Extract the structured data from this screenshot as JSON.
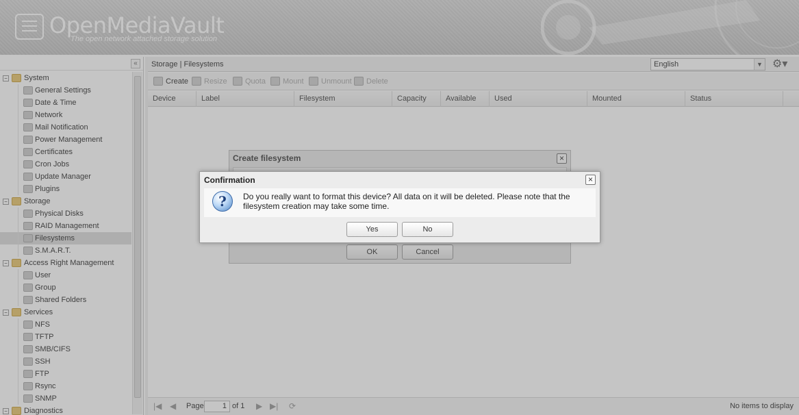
{
  "header": {
    "title": "OpenMediaVault",
    "subtitle": "The open network attached storage solution"
  },
  "sidebar": {
    "tree": [
      {
        "type": "category",
        "label": "System",
        "icon": "folder-icon",
        "expanded": true
      },
      {
        "type": "leaf",
        "label": "General Settings",
        "icon": "tools-icon"
      },
      {
        "type": "leaf",
        "label": "Date & Time",
        "icon": "clock-icon"
      },
      {
        "type": "leaf",
        "label": "Network",
        "icon": "network-icon"
      },
      {
        "type": "leaf",
        "label": "Mail Notification",
        "icon": "mail-icon"
      },
      {
        "type": "leaf",
        "label": "Power Management",
        "icon": "power-icon"
      },
      {
        "type": "leaf",
        "label": "Certificates",
        "icon": "certificate-icon"
      },
      {
        "type": "leaf",
        "label": "Cron Jobs",
        "icon": "cron-icon"
      },
      {
        "type": "leaf",
        "label": "Update Manager",
        "icon": "update-icon"
      },
      {
        "type": "leaf",
        "label": "Plugins",
        "icon": "plugin-icon"
      },
      {
        "type": "category",
        "label": "Storage",
        "icon": "folder-icon",
        "expanded": true
      },
      {
        "type": "leaf",
        "label": "Physical Disks",
        "icon": "disk-icon"
      },
      {
        "type": "leaf",
        "label": "RAID Management",
        "icon": "raid-icon"
      },
      {
        "type": "leaf",
        "label": "Filesystems",
        "icon": "filesystem-icon",
        "selected": true
      },
      {
        "type": "leaf",
        "label": "S.M.A.R.T.",
        "icon": "smart-icon"
      },
      {
        "type": "category",
        "label": "Access Right Management",
        "icon": "folder-icon",
        "expanded": true
      },
      {
        "type": "leaf",
        "label": "User",
        "icon": "user-icon"
      },
      {
        "type": "leaf",
        "label": "Group",
        "icon": "group-icon"
      },
      {
        "type": "leaf",
        "label": "Shared Folders",
        "icon": "shared-folder-icon"
      },
      {
        "type": "category",
        "label": "Services",
        "icon": "folder-icon",
        "expanded": true
      },
      {
        "type": "leaf",
        "label": "NFS",
        "icon": "nfs-icon"
      },
      {
        "type": "leaf",
        "label": "TFTP",
        "icon": "tftp-icon"
      },
      {
        "type": "leaf",
        "label": "SMB/CIFS",
        "icon": "smb-icon"
      },
      {
        "type": "leaf",
        "label": "SSH",
        "icon": "ssh-icon"
      },
      {
        "type": "leaf",
        "label": "FTP",
        "icon": "ftp-icon"
      },
      {
        "type": "leaf",
        "label": "Rsync",
        "icon": "rsync-icon"
      },
      {
        "type": "leaf",
        "label": "SNMP",
        "icon": "snmp-icon"
      },
      {
        "type": "category",
        "label": "Diagnostics",
        "icon": "folder-icon",
        "expanded": true
      }
    ]
  },
  "main": {
    "breadcrumb": "Storage | Filesystems",
    "language": "English",
    "toolbar": {
      "create": "Create",
      "resize": "Resize",
      "quota": "Quota",
      "mount": "Mount",
      "unmount": "Unmount",
      "delete": "Delete"
    },
    "columns": [
      "Device",
      "Label",
      "Filesystem",
      "Capacity",
      "Available",
      "Used",
      "Mounted",
      "Status"
    ],
    "paging": {
      "page_label": "Page",
      "page_value": "1",
      "of_label": "of 1",
      "status": "No items to display"
    }
  },
  "create_dialog": {
    "title": "Create filesystem",
    "ok": "OK",
    "cancel": "Cancel"
  },
  "confirm_dialog": {
    "title": "Confirmation",
    "message": "Do you really want to format this device? All data on it will be deleted. Please note that the filesystem creation may take some time.",
    "yes": "Yes",
    "no": "No"
  }
}
